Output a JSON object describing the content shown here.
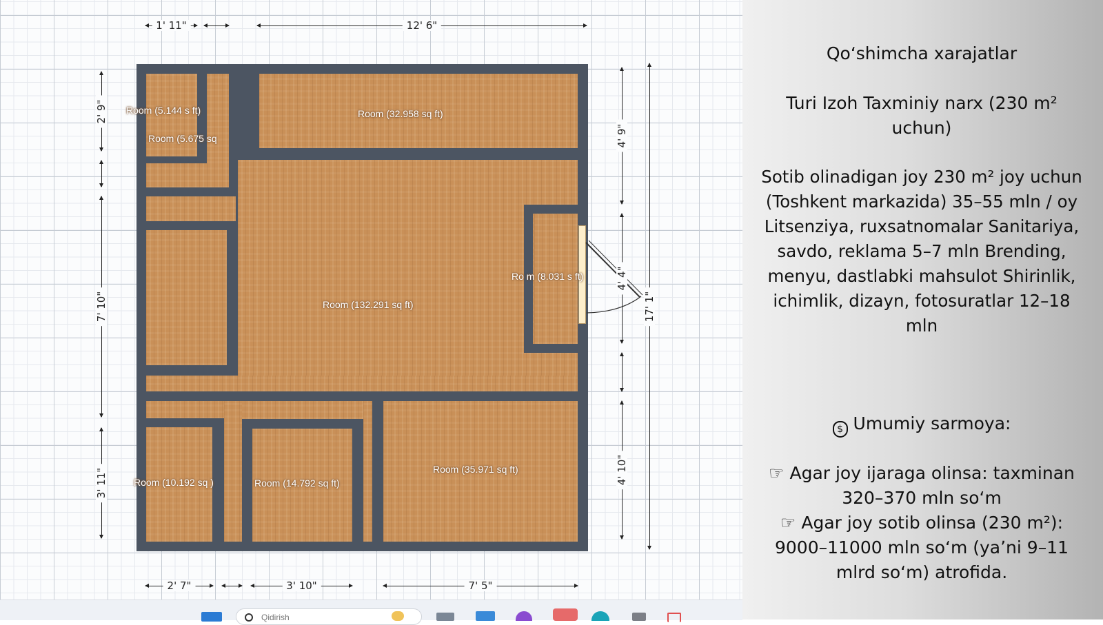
{
  "floor_plan": {
    "rooms": [
      {
        "id": "r1",
        "label": "Room (5.144 s   ft)"
      },
      {
        "id": "r2",
        "label": "Room (5.675 sq"
      },
      {
        "id": "r3",
        "label": "Room (32.958 sq ft)"
      },
      {
        "id": "r4",
        "label": "Room (132.291 sq ft)"
      },
      {
        "id": "r5",
        "label": "Ro  m (8.031 s    ft)"
      },
      {
        "id": "r6",
        "label": "Room (10.192 sq   )"
      },
      {
        "id": "r7",
        "label": "Room (14.792 sq ft)"
      },
      {
        "id": "r8",
        "label": "Room (35.971 sq ft)"
      }
    ],
    "dimensions": {
      "top_left": "1' 11\"",
      "top_right": "12' 6\"",
      "left_1": "2' 9\"",
      "left_2": "7' 10\"",
      "left_3": "3' 11\"",
      "right_1": "4' 9\"",
      "right_2": "4' 4\"",
      "right_3": "4' 10\"",
      "right_total": "17' 1\"",
      "bottom_1": "2' 7\"",
      "bottom_2": "3' 10\"",
      "bottom_3": "7' 5\""
    }
  },
  "info": {
    "title": "Qoʻshimcha xarajatlar",
    "header_row": "Turi Izoh Taxminiy narx (230 m² uchun)",
    "rows": "Sotib olinadigan joy 230 m² joy uchun (Toshkent markazida) 35–55 mln / oy Litsenziya, ruxsatnomalar Sanitariya, savdo, reklama 5–7 mln Brending, menyu, dastlabki mahsulot Shirinlik, ichimlik, dizayn, fotosuratlar 12–18 mln",
    "total_icon": "money-bag-icon",
    "total_label": "Umumiy sarmoya:",
    "pointer_icon": "pointing-hand-icon",
    "option_1": "Agar joy ijaraga olinsa: taxminan 320–370 mln soʻm",
    "option_2": "Agar joy sotib olinsa (230 m²): 9000–11000 mln soʻm (yaʼni 9–11 mlrd soʻm) atrofida."
  },
  "taskbar": {
    "search_placeholder": "Qidirish",
    "icons": [
      "windows-start-icon",
      "search-icon",
      "widgets-icon",
      "file-explorer-icon",
      "store-icon",
      "browser-icon",
      "app-icon",
      "edge-icon",
      "game-icon",
      "snipping-icon"
    ]
  },
  "colors": {
    "wall": "#4c5562",
    "floor": "#c99058",
    "grid": "#c6ccd4"
  }
}
